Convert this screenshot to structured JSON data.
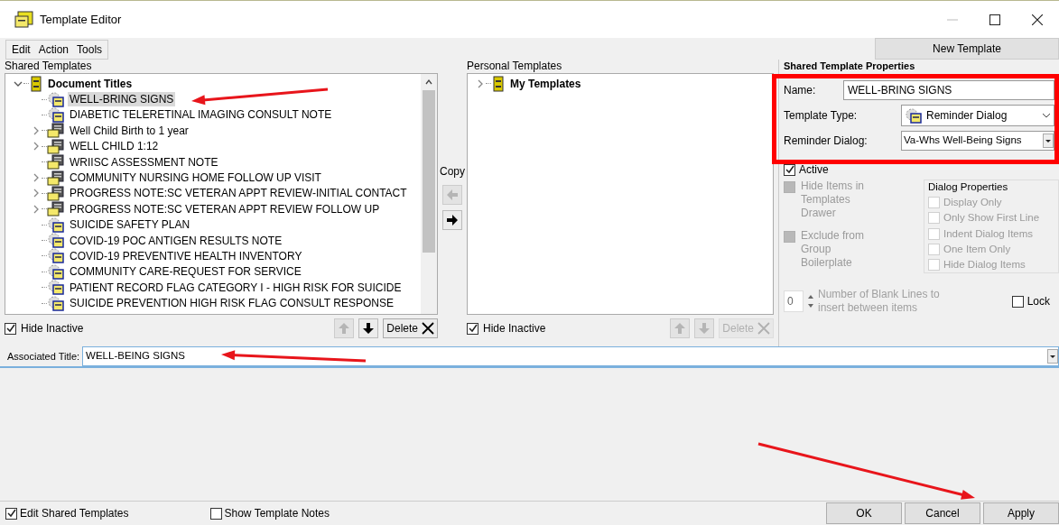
{
  "window": {
    "title": "Template Editor"
  },
  "menu": [
    "Edit",
    "Action",
    "Tools"
  ],
  "new_template_button": "New Template",
  "shared_templates": {
    "label": "Shared Templates",
    "tree": [
      {
        "label": "Document Titles",
        "kind": "root",
        "expanded": true,
        "selected": false,
        "children": [
          {
            "label": "WELL-BRING SIGNS",
            "kind": "dialog",
            "selected": true
          },
          {
            "label": "DIABETIC TELERETINAL IMAGING CONSULT NOTE",
            "kind": "dialog",
            "selected": false
          },
          {
            "label": "Well Child Birth to 1 year",
            "kind": "folder",
            "expanded": false,
            "selected": false
          },
          {
            "label": "WELL CHILD 1:12",
            "kind": "folder",
            "expanded": false,
            "selected": false
          },
          {
            "label": "WRIISC ASSESSMENT NOTE",
            "kind": "folder",
            "selected": false
          },
          {
            "label": "COMMUNITY NURSING HOME FOLLOW UP VISIT",
            "kind": "folder",
            "expanded": false,
            "selected": false
          },
          {
            "label": "PROGRESS NOTE:SC VETERAN APPT REVIEW-INITIAL CONTACT",
            "kind": "folder",
            "expanded": false,
            "selected": false
          },
          {
            "label": "PROGRESS NOTE:SC VETERAN APPT REVIEW FOLLOW UP",
            "kind": "folder",
            "expanded": false,
            "selected": false
          },
          {
            "label": "SUICIDE SAFETY PLAN",
            "kind": "dialog",
            "selected": false
          },
          {
            "label": "COVID-19 POC ANTIGEN RESULTS NOTE",
            "kind": "dialog",
            "selected": false
          },
          {
            "label": "COVID-19 PREVENTIVE HEALTH INVENTORY",
            "kind": "dialog",
            "selected": false
          },
          {
            "label": "COMMUNITY CARE-REQUEST FOR SERVICE",
            "kind": "dialog",
            "selected": false
          },
          {
            "label": "PATIENT RECORD FLAG CATEGORY I - HIGH RISK FOR SUICIDE",
            "kind": "dialog",
            "selected": false
          },
          {
            "label": "SUICIDE PREVENTION HIGH RISK FLAG CONSULT RESPONSE",
            "kind": "dialog",
            "selected": false
          }
        ]
      }
    ],
    "hide_inactive": {
      "label": "Hide Inactive",
      "checked": true
    },
    "delete_button": {
      "label": "Delete",
      "disabled": false
    }
  },
  "copy_label": "Copy",
  "personal_templates": {
    "label": "Personal Templates",
    "tree": [
      {
        "label": "My Templates",
        "kind": "root",
        "expanded": false,
        "selected": false
      }
    ],
    "hide_inactive": {
      "label": "Hide Inactive",
      "checked": true
    },
    "delete_button": {
      "label": "Delete",
      "disabled": true
    }
  },
  "properties": {
    "title": "Shared Template Properties",
    "name": {
      "label": "Name:",
      "value": "WELL-BRING SIGNS"
    },
    "template_type": {
      "label": "Template Type:",
      "value": "Reminder Dialog"
    },
    "reminder_dialog": {
      "label": "Reminder Dialog:",
      "value": "Va-Whs Well-Being Signs"
    },
    "active": {
      "label": "Active",
      "checked": true
    },
    "hide_items": {
      "label": "Hide Items in Templates Drawer",
      "checked": false,
      "disabled": true
    },
    "exclude": {
      "label": "Exclude from Group Boilerplate",
      "checked": false,
      "disabled": true
    },
    "dialog_properties": {
      "title": "Dialog Properties",
      "options": [
        {
          "label": "Display Only",
          "checked": false
        },
        {
          "label": "Only Show First Line",
          "checked": false
        },
        {
          "label": "Indent Dialog Items",
          "checked": false
        },
        {
          "label": "One Item Only",
          "checked": false
        },
        {
          "label": "Hide Dialog Items",
          "checked": false
        }
      ]
    },
    "blank_lines": {
      "value": "0",
      "label": "Number of Blank Lines to insert between items"
    },
    "lock": {
      "label": "Lock",
      "checked": false
    }
  },
  "associated_title": {
    "label": "Associated Title:",
    "value": "WELL-BEING SIGNS"
  },
  "footer": {
    "edit_shared": {
      "label": "Edit Shared Templates",
      "checked": true
    },
    "show_notes": {
      "label": "Show Template Notes",
      "checked": false
    },
    "buttons": [
      "OK",
      "Cancel",
      "Apply"
    ]
  }
}
